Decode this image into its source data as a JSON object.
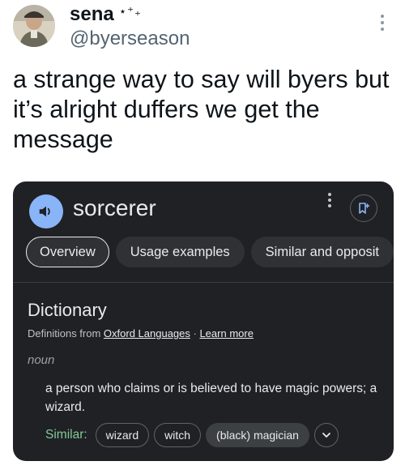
{
  "tweet": {
    "display_name": "sena",
    "name_decoration": "⋆⁺₊",
    "handle": "@byerseason",
    "text": "a strange way to say will byers but it’s alright duffers we get the message"
  },
  "dictionary_card": {
    "word": "sorcerer",
    "tabs": [
      {
        "label": "Overview",
        "active": true
      },
      {
        "label": "Usage examples",
        "active": false
      },
      {
        "label": "Similar and opposit",
        "active": false
      }
    ],
    "section_title": "Dictionary",
    "source_prefix": "Definitions from ",
    "source_link": "Oxford Languages",
    "separator": " · ",
    "learn_more": "Learn more",
    "part_of_speech": "noun",
    "definition": "a person who claims or is believed to have magic powers; a wizard.",
    "similar_label": "Similar:",
    "similar_chips": [
      "wizard",
      "witch",
      "(black) magician"
    ]
  },
  "colors": {
    "card_bg": "#202124",
    "speaker_accent": "#8ab4f8",
    "similar_green": "#81c995"
  },
  "icons": [
    "avatar-photo",
    "more-icon",
    "speaker-icon",
    "kebab-menu-icon",
    "save-icon",
    "chevron-down-icon"
  ]
}
